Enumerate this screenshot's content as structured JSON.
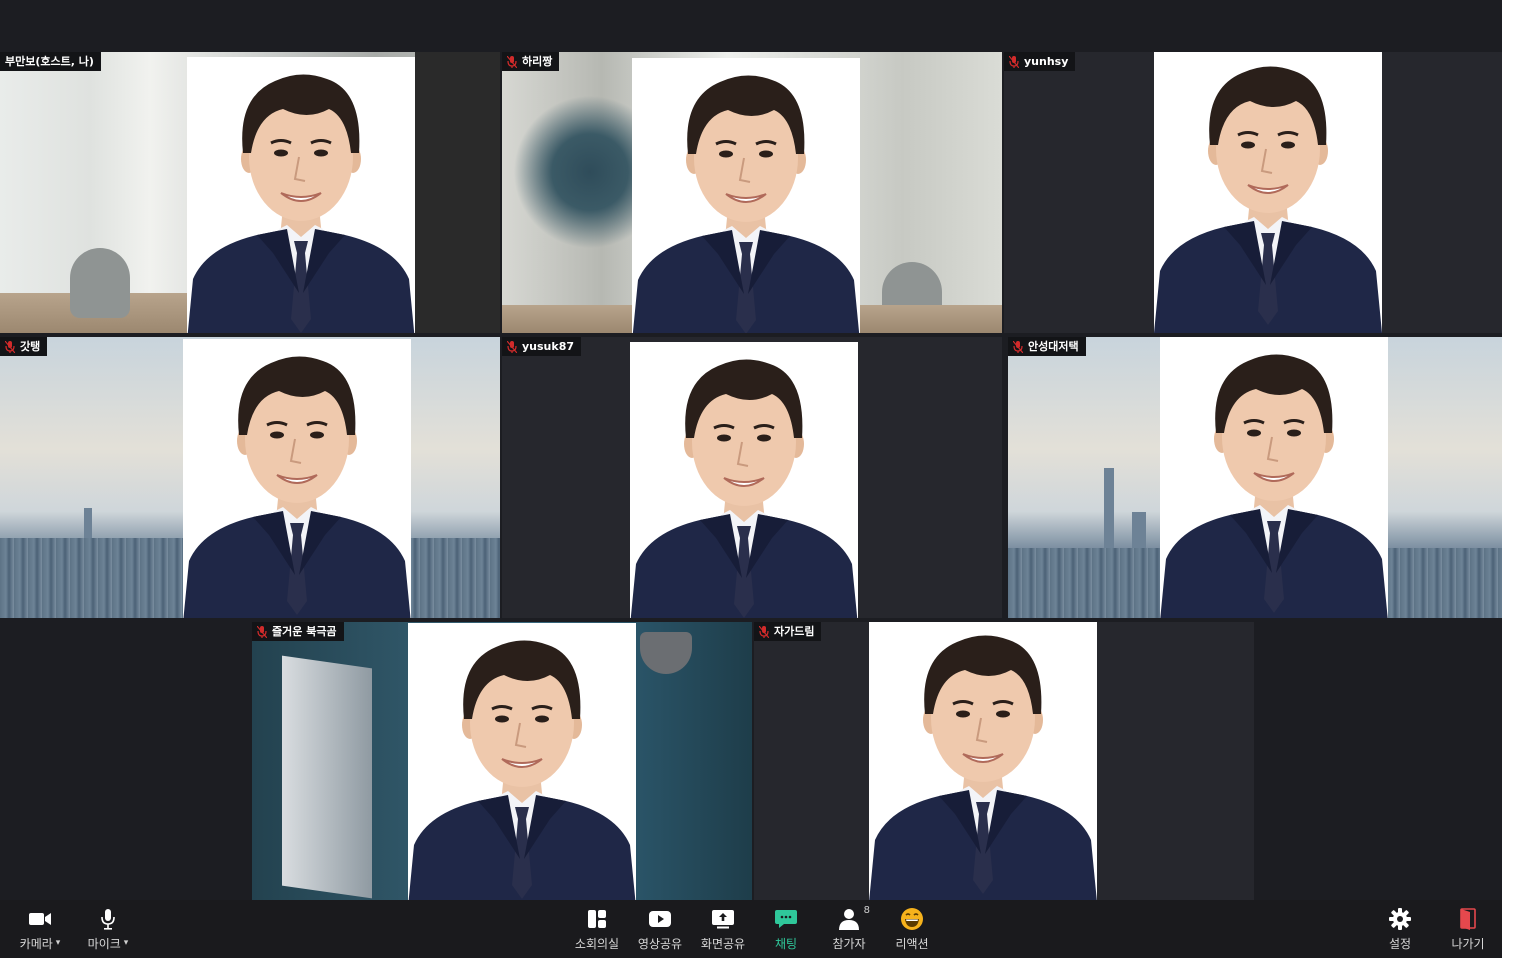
{
  "participants": [
    {
      "name": "부만보(호스트, 나)"
    },
    {
      "name": "하리짱"
    },
    {
      "name": "yunhsy"
    },
    {
      "name": "갓탱"
    },
    {
      "name": "yusuk87"
    },
    {
      "name": "안성대저택"
    },
    {
      "name": "즐거운 북극곰"
    },
    {
      "name": "자가드림"
    }
  ],
  "toolbar": {
    "camera": "카메라",
    "mic": "마이크",
    "breakout": "소회의실",
    "share_video": "영상공유",
    "share_screen": "화면공유",
    "chat": "채팅",
    "participants": "참가자",
    "participants_count": "8",
    "reactions": "리액션",
    "settings": "설정",
    "leave": "나가기"
  },
  "colors": {
    "chat_active": "#2fc79a",
    "leave_icon": "#e5484d",
    "muted_mic": "#d22b2b"
  },
  "icons": {
    "camera": "video-camera-icon",
    "mic": "microphone-icon",
    "breakout": "grid-layout-icon",
    "share_video": "play-icon",
    "share_screen": "upload-screen-icon",
    "chat": "chat-bubble-icon",
    "participants": "person-icon",
    "reactions": "emoji-icon",
    "settings": "gear-icon",
    "leave": "exit-door-icon"
  }
}
